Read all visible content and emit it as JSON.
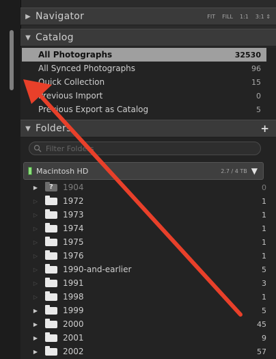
{
  "navigator": {
    "title": "Navigator",
    "controls": [
      "FIT",
      "FILL",
      "1:1",
      "3:1 ⇕"
    ]
  },
  "catalog": {
    "title": "Catalog",
    "items": [
      {
        "label": "All Photographs",
        "count": "32530",
        "selected": true
      },
      {
        "label": "All Synced Photographs",
        "count": "96"
      },
      {
        "label": "Quick Collection",
        "count": "15"
      },
      {
        "label": "Previous Import",
        "count": "0"
      },
      {
        "label": "Previous Export as Catalog",
        "count": "5"
      }
    ]
  },
  "folders": {
    "title": "Folders",
    "add_label": "+",
    "filter_placeholder": "Filter Folders",
    "volume": {
      "name": "Macintosh HD",
      "size": "2.7 / 4 TB"
    },
    "items": [
      {
        "name": "1904",
        "count": "0",
        "missing": true,
        "expandable": true
      },
      {
        "name": "1972",
        "count": "1",
        "expandable": false
      },
      {
        "name": "1973",
        "count": "1",
        "expandable": false
      },
      {
        "name": "1974",
        "count": "1",
        "expandable": false
      },
      {
        "name": "1975",
        "count": "1",
        "expandable": false
      },
      {
        "name": "1976",
        "count": "1",
        "expandable": false
      },
      {
        "name": "1990-and-earlier",
        "count": "5",
        "expandable": false
      },
      {
        "name": "1991",
        "count": "3",
        "expandable": false
      },
      {
        "name": "1998",
        "count": "1",
        "expandable": false
      },
      {
        "name": "1999",
        "count": "5",
        "expandable": true
      },
      {
        "name": "2000",
        "count": "45",
        "expandable": true
      },
      {
        "name": "2001",
        "count": "9",
        "expandable": true
      },
      {
        "name": "2002",
        "count": "57",
        "expandable": true
      }
    ]
  },
  "colors": {
    "selection": "#9f9f9f",
    "annotation_arrow": "#e8402a",
    "volume_led": "#8de07c"
  }
}
